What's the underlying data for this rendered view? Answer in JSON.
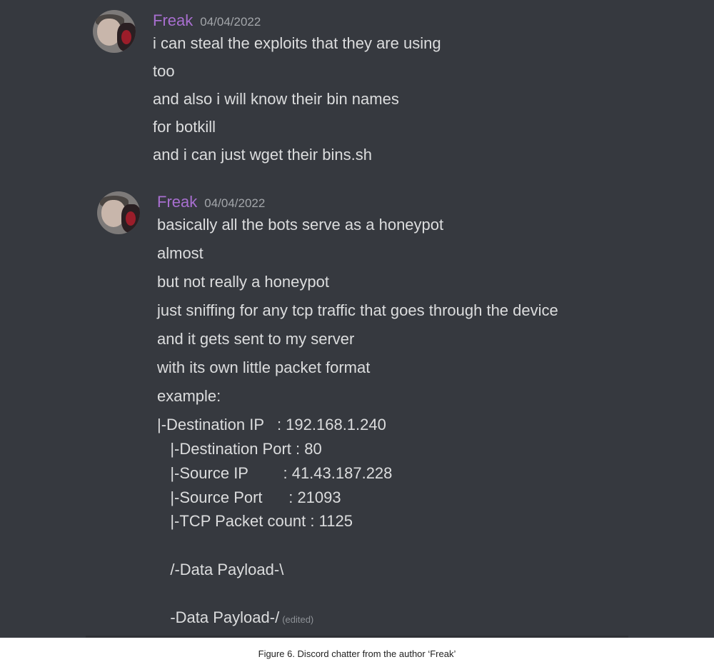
{
  "messages": [
    {
      "author": "Freak",
      "timestamp": "04/04/2022",
      "lines": [
        "i can steal the exploits that they are using",
        "too",
        "and also i will know their bin names",
        "for botkill",
        "and i can just wget their bins.sh"
      ]
    },
    {
      "author": "Freak",
      "timestamp": "04/04/2022",
      "lines": [
        "basically all the bots serve as a honeypot",
        "almost",
        "but not really a honeypot",
        "just sniffing for any tcp traffic that goes through the device",
        "and it gets sent to my server",
        "with its own little packet format",
        "example:",
        "|-Destination IP   : 192.168.1.240",
        "   |-Destination Port : 80",
        "   |-Source IP        : 41.43.187.228",
        "   |-Source Port      : 21093",
        "   |-TCP Packet count : 1125",
        "   /-Data Payload-\\",
        "   -Data Payload-/"
      ],
      "edited_label": "(edited)"
    }
  ],
  "caption": "Figure 6. Discord chatter from the author ‘Freak’",
  "colors": {
    "background": "#36393f",
    "username": "#a86fd0",
    "text": "#dcddde",
    "timestamp": "#a3a6aa"
  }
}
